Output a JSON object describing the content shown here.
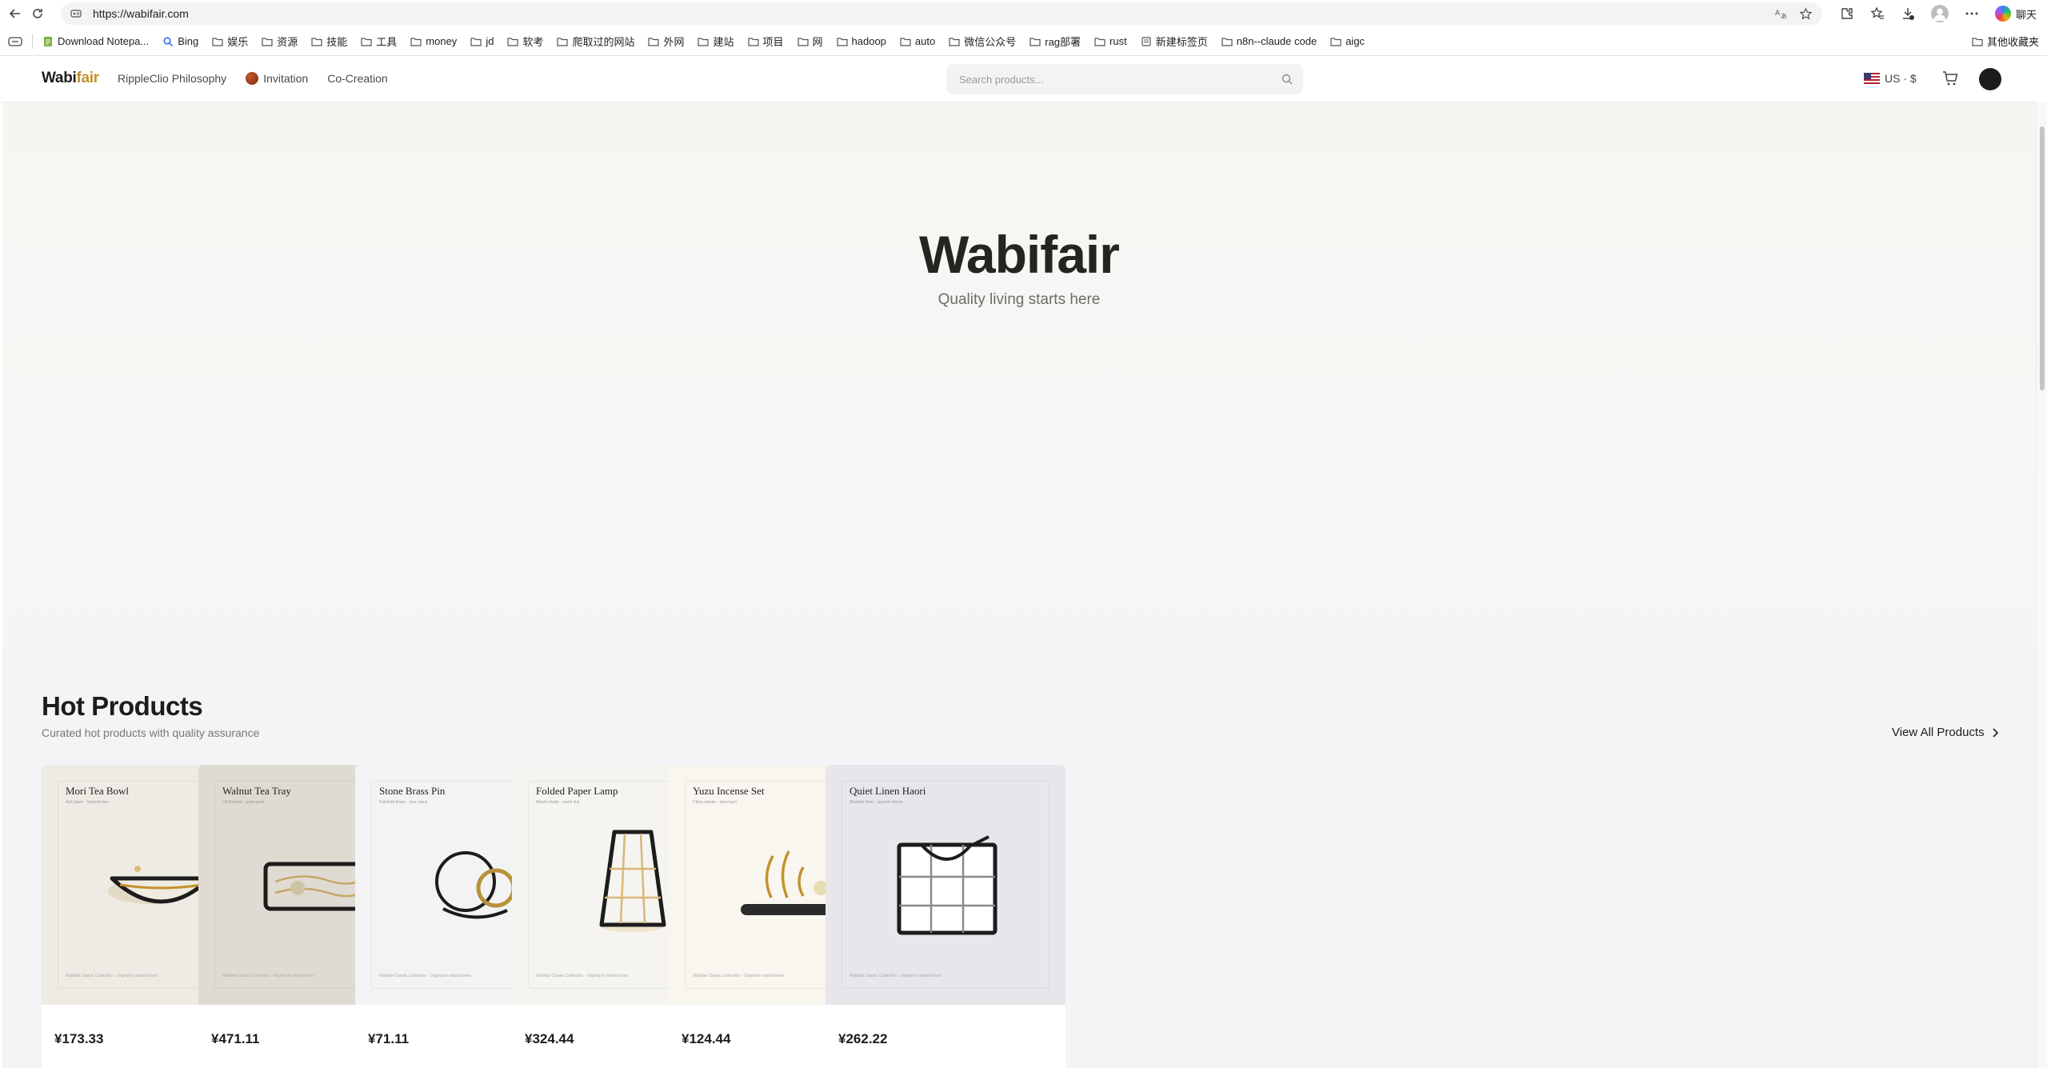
{
  "browser": {
    "url": "https://wabifair.com",
    "copilot_label": "聊天",
    "bookmarks": [
      {
        "label": "Download Notepa...",
        "icon": "notepad-icon"
      },
      {
        "label": "Bing",
        "icon": "search-icon"
      },
      {
        "label": "娱乐",
        "icon": "folder-icon"
      },
      {
        "label": "资源",
        "icon": "folder-icon"
      },
      {
        "label": "技能",
        "icon": "folder-icon"
      },
      {
        "label": "工具",
        "icon": "folder-icon"
      },
      {
        "label": "money",
        "icon": "folder-icon"
      },
      {
        "label": "jd",
        "icon": "folder-icon"
      },
      {
        "label": "软考",
        "icon": "folder-icon"
      },
      {
        "label": "爬取过的网站",
        "icon": "folder-icon"
      },
      {
        "label": "外网",
        "icon": "folder-icon"
      },
      {
        "label": "建站",
        "icon": "folder-icon"
      },
      {
        "label": "项目",
        "icon": "folder-icon"
      },
      {
        "label": "网",
        "icon": "folder-icon"
      },
      {
        "label": "hadoop",
        "icon": "folder-icon"
      },
      {
        "label": "auto",
        "icon": "folder-icon"
      },
      {
        "label": "微信公众号",
        "icon": "folder-icon"
      },
      {
        "label": "rag部署",
        "icon": "folder-icon"
      },
      {
        "label": "rust",
        "icon": "folder-icon"
      },
      {
        "label": "新建标签页",
        "icon": "page-icon"
      },
      {
        "label": "n8n--claude code",
        "icon": "folder-icon"
      },
      {
        "label": "aigc",
        "icon": "folder-icon"
      }
    ],
    "other_bookmarks": "其他收藏夹"
  },
  "header": {
    "logo_main": "Wabi",
    "logo_accent": "fair",
    "nav": [
      "RippleClio Philosophy",
      "Invitation",
      "Co-Creation"
    ],
    "search_placeholder": "Search products...",
    "locale": "US · $"
  },
  "hero": {
    "title": "Wabifair",
    "subtitle": "Quality living starts here"
  },
  "products": {
    "title": "Hot Products",
    "subtitle": "Curated hot products with quality assurance",
    "view_all": "View All Products",
    "items": [
      {
        "name": "Mori Tea Bowl",
        "tag": "Ash glaze · hand thrown",
        "foot": "Wabifair Classic Collection · Original in muted tones",
        "price": "¥173.33",
        "bg": "#eeebe4",
        "art": "bowl"
      },
      {
        "name": "Walnut Tea Tray",
        "tag": "Oil finished · quiet grain",
        "foot": "Wabifair Classic Collection · Original in muted tones",
        "price": "¥471.11",
        "bg": "#e0dbd2",
        "art": "tray"
      },
      {
        "name": "Stone Brass Pin",
        "tag": "Polished brass · river stone",
        "foot": "Wabifair Classic Collection · Original in muted tones",
        "price": "¥71.11",
        "bg": "#f3f3f4",
        "art": "pin"
      },
      {
        "name": "Folded Paper Lamp",
        "tag": "Washi shade · warm line",
        "foot": "Wabifair Classic Collection · Original in muted tones",
        "price": "¥324.44",
        "bg": "#f6f4f0",
        "art": "lamp"
      },
      {
        "name": "Yuzu Incense Set",
        "tag": "Citrus smoke · slow burn",
        "foot": "Wabifair Classic Collection · Original in muted tones",
        "price": "¥124.44",
        "bg": "#f9f6ef",
        "art": "incense"
      },
      {
        "name": "Quiet Linen Haori",
        "tag": "Washed linen · layered sleeve",
        "foot": "Wabifair Classic Collection · Original in muted tones",
        "price": "¥262.22",
        "bg": "#e7e6ea",
        "art": "haori"
      }
    ]
  },
  "colors": {
    "accent": "#c3922e",
    "text": "#1c1c1c",
    "section_bg": "#f4f4f6"
  }
}
